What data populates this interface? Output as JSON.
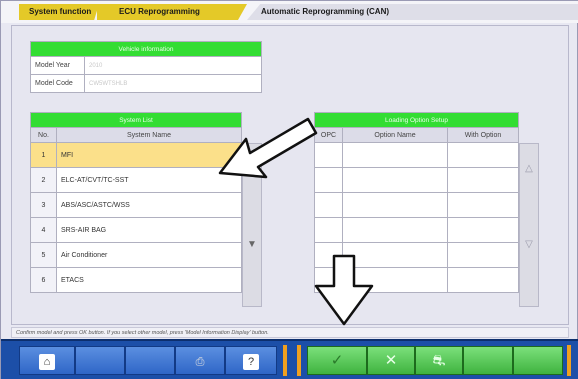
{
  "tabs": {
    "system_function": "System function",
    "ecu_reprogramming": "ECU Reprogramming",
    "automatic_reprogramming": "Automatic Reprogramming (CAN)"
  },
  "vehicle": {
    "header": "Vehicle information",
    "model_year_label": "Model Year",
    "model_year_value": "2010",
    "model_code_label": "Model Code",
    "model_code_value": "CW5WTSHLB"
  },
  "system_list": {
    "header": "System List",
    "col_no": "No.",
    "col_name": "System Name",
    "rows": [
      {
        "no": "1",
        "name": "MFI"
      },
      {
        "no": "2",
        "name": "ELC-AT/CVT/TC-SST"
      },
      {
        "no": "3",
        "name": "ABS/ASC/ASTC/WSS"
      },
      {
        "no": "4",
        "name": "SRS-AIR BAG"
      },
      {
        "no": "5",
        "name": "Air Conditioner"
      },
      {
        "no": "6",
        "name": "ETACS"
      }
    ],
    "selected_index": 0
  },
  "option_setup": {
    "header": "Loading Option Setup",
    "col_opc": "OPC",
    "col_option_name": "Option Name",
    "col_with_option": "With Option"
  },
  "hint_text": "Confirm model and press OK button. If you select other model, press 'Model Information Display' button.",
  "toolbar": {
    "home_icon": "home-icon",
    "printer_icon": "printer-icon",
    "help_label": "?",
    "ok_icon": "check-icon",
    "cancel_icon": "cross-icon",
    "vehicle_icon": "car-icon"
  },
  "colors": {
    "green_header": "#33dd33",
    "tab_active": "#e4c928",
    "toolbar_blue": "#1c4fa8",
    "selected_row": "#fbe08a"
  }
}
